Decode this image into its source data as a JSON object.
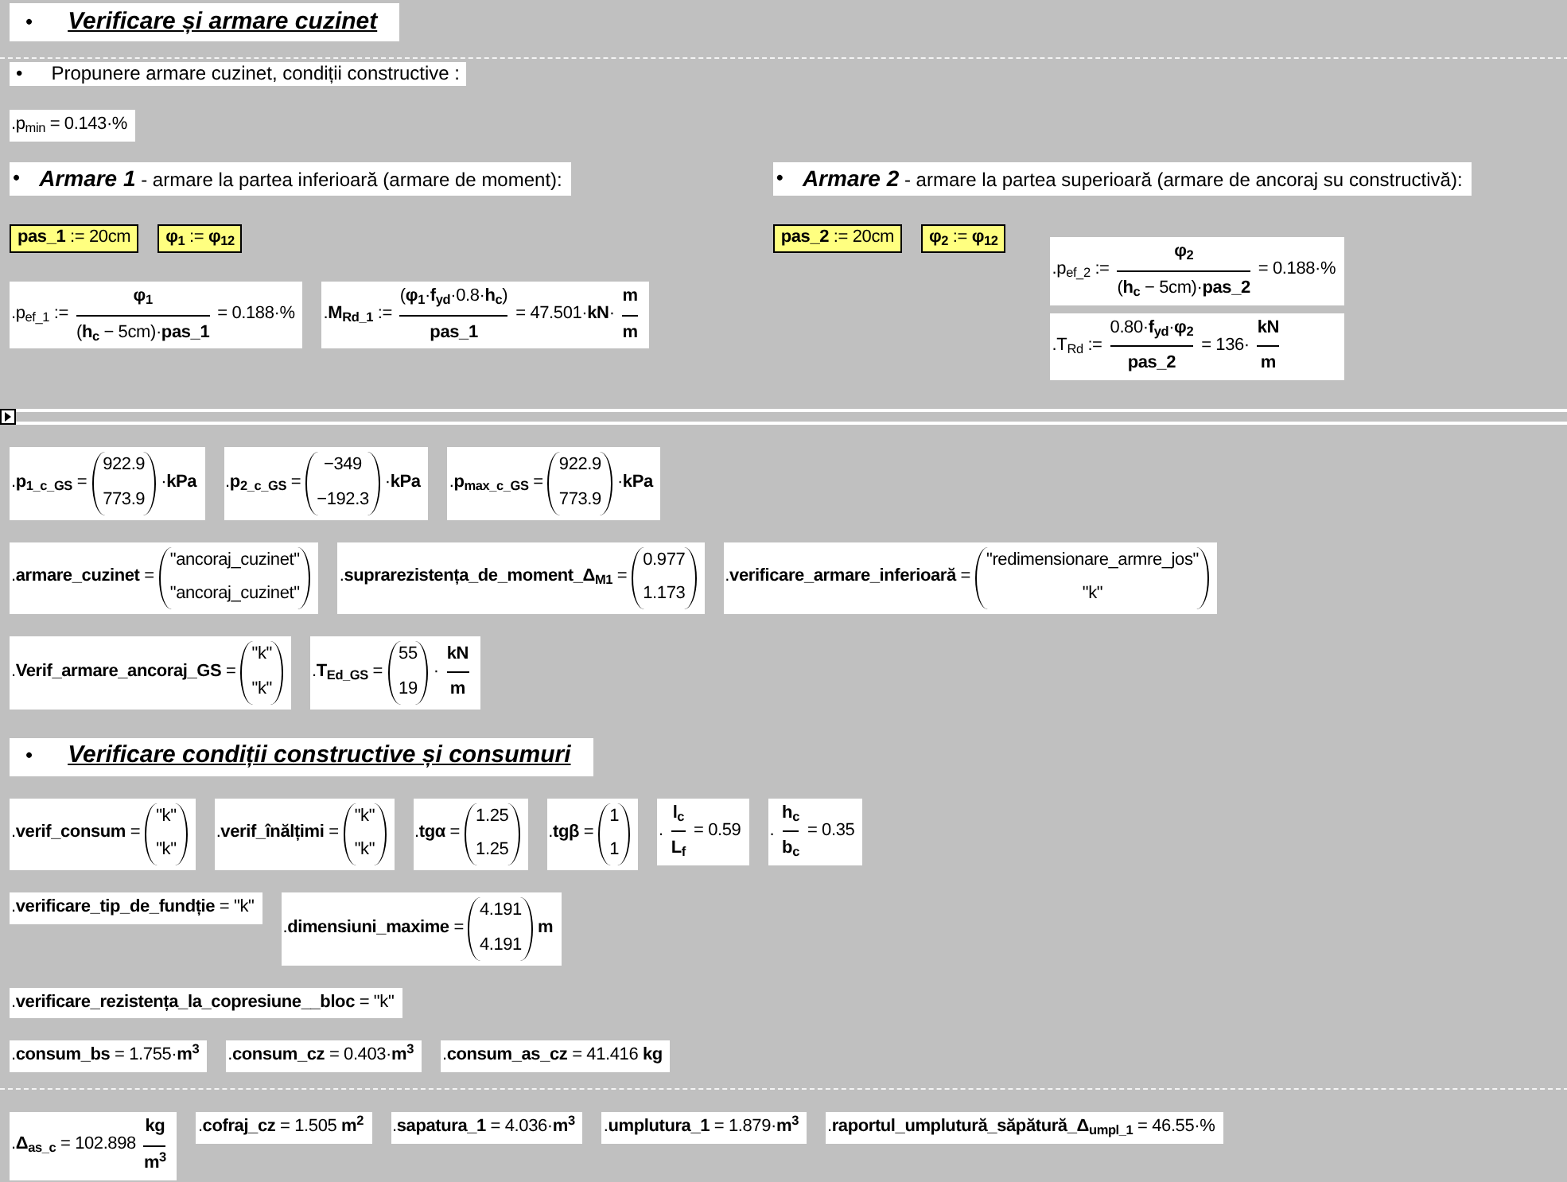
{
  "worksheet": {
    "blocks": [
      {
        "kind": "heading",
        "bullet": "•",
        "title": "Verificare și armare cuzinet"
      },
      {
        "kind": "page-break"
      },
      {
        "kind": "note",
        "bullet": "•",
        "text": "Propunere armare cuzinet, condiții constructive :"
      },
      {
        "kind": "math",
        "regions": [
          {
            "kind": "region",
            "parts": [
              {
                "kind": "text",
                "text": ".p$_{min}$ = 0.143·%"
              }
            ]
          }
        ]
      },
      {
        "kind": "columns",
        "columns": [
          {
            "blocks": [
              {
                "kind": "subheading",
                "bullet": "•",
                "title": "Armare 1",
                "text": "- armare la partea inferioară (armare de moment):"
              },
              {
                "kind": "math",
                "regions": [
                  {
                    "kind": "definition",
                    "parts": [
                      {
                        "kind": "text",
                        "text": "**pas_1** := 20cm"
                      }
                    ]
                  },
                  {
                    "kind": "definition",
                    "parts": [
                      {
                        "kind": "text",
                        "text": "**φ$_{1}$** := **φ$_{12}$**"
                      }
                    ]
                  }
                ]
              },
              {
                "kind": "math",
                "regions": [
                  {
                    "kind": "region",
                    "parts": [
                      {
                        "kind": "text",
                        "text": ".p$_{ef_1}$ :="
                      },
                      {
                        "kind": "frac",
                        "num": "**φ$_{1}$**",
                        "den": "(**h$_{c}$** − 5cm)·**pas_1**"
                      },
                      {
                        "kind": "text",
                        "text": "= 0.188·%"
                      }
                    ]
                  },
                  {
                    "kind": "region",
                    "parts": [
                      {
                        "kind": "text",
                        "text": ".**M$_{Rd_1}$** :="
                      },
                      {
                        "kind": "frac",
                        "num": "(**φ$_{1}$**·**f$_{yd}$**·0.8·**h$_{c}$**)",
                        "den": "**pas_1**"
                      },
                      {
                        "kind": "text",
                        "text": "= 47.501·**kN**·"
                      },
                      {
                        "kind": "frac",
                        "num": "**m**",
                        "den": "**m**"
                      }
                    ]
                  }
                ]
              }
            ]
          },
          {
            "blocks": [
              {
                "kind": "subheading",
                "bullet": "•",
                "title": "Armare 2",
                "text": "- armare la partea superioară (armare de ancoraj su constructivă):"
              },
              {
                "kind": "math",
                "regions": [
                  {
                    "kind": "definition",
                    "parts": [
                      {
                        "kind": "text",
                        "text": "**pas_2** := 20cm"
                      }
                    ]
                  },
                  {
                    "kind": "definition",
                    "parts": [
                      {
                        "kind": "text",
                        "text": "**φ$_{2}$** := **φ$_{12}$**"
                      }
                    ]
                  },
                  {
                    "kind": "stack",
                    "regions": [
                      {
                        "kind": "region",
                        "parts": [
                          {
                            "kind": "text",
                            "text": ".p$_{ef_2}$ :="
                          },
                          {
                            "kind": "frac",
                            "num": "**φ$_{2}$**",
                            "den": "(**h$_{c}$** − 5cm)·**pas_2**"
                          },
                          {
                            "kind": "text",
                            "text": "= 0.188·%"
                          }
                        ]
                      },
                      {
                        "kind": "region",
                        "parts": [
                          {
                            "kind": "text",
                            "text": ".T$_{Rd}$ :="
                          },
                          {
                            "kind": "frac",
                            "num": "0.80·**f$_{yd}$**·**φ$_{2}$**",
                            "den": "**pas_2**"
                          },
                          {
                            "kind": "text",
                            "text": "= 136·"
                          },
                          {
                            "kind": "frac",
                            "num": "**kN**",
                            "den": "**m**"
                          }
                        ]
                      }
                    ]
                  }
                ]
              }
            ]
          }
        ]
      },
      {
        "kind": "area-bar"
      },
      {
        "kind": "math",
        "regions": [
          {
            "kind": "region",
            "parts": [
              {
                "kind": "text",
                "text": ".**p$_{1_c_GS}$** ="
              },
              {
                "kind": "matrix",
                "rows": [
                  "922.9",
                  "773.9"
                ]
              },
              {
                "kind": "text",
                "text": "·**kPa**"
              }
            ]
          },
          {
            "kind": "region",
            "parts": [
              {
                "kind": "text",
                "text": ".**p$_{2_c_GS}$** ="
              },
              {
                "kind": "matrix",
                "rows": [
                  "−349",
                  "−192.3"
                ]
              },
              {
                "kind": "text",
                "text": "·**kPa**"
              }
            ]
          },
          {
            "kind": "region",
            "parts": [
              {
                "kind": "text",
                "text": ".**p$_{max_c_GS}$** ="
              },
              {
                "kind": "matrix",
                "rows": [
                  "922.9",
                  "773.9"
                ]
              },
              {
                "kind": "text",
                "text": "·**kPa**"
              }
            ]
          }
        ]
      },
      {
        "kind": "math",
        "regions": [
          {
            "kind": "region",
            "parts": [
              {
                "kind": "text",
                "text": ".**armare_cuzinet** ="
              },
              {
                "kind": "matrix",
                "rows": [
                  "\"ancoraj_cuzinet\"",
                  "\"ancoraj_cuzinet\""
                ]
              }
            ]
          },
          {
            "kind": "region",
            "parts": [
              {
                "kind": "text",
                "text": ".**suprarezistența_de_moment_Δ$_{M1}$** ="
              },
              {
                "kind": "matrix",
                "rows": [
                  "0.977",
                  "1.173"
                ]
              }
            ]
          },
          {
            "kind": "region",
            "parts": [
              {
                "kind": "text",
                "text": ".**verificare_armare_inferioară** ="
              },
              {
                "kind": "matrix",
                "rows": [
                  "\"redimensionare_armre_jos\"",
                  "\"k\""
                ]
              }
            ]
          }
        ]
      },
      {
        "kind": "math",
        "regions": [
          {
            "kind": "region",
            "parts": [
              {
                "kind": "text",
                "text": ".**Verif_armare_ancoraj_GS** ="
              },
              {
                "kind": "matrix",
                "rows": [
                  "\"k\"",
                  "\"k\""
                ]
              }
            ]
          },
          {
            "kind": "region",
            "parts": [
              {
                "kind": "text",
                "text": ".**T$_{Ed_GS}$** ="
              },
              {
                "kind": "matrix",
                "rows": [
                  "55",
                  "19"
                ]
              },
              {
                "kind": "text",
                "text": "·"
              },
              {
                "kind": "frac",
                "num": "**kN**",
                "den": "**m**"
              }
            ]
          }
        ]
      },
      {
        "kind": "heading",
        "bullet": "•",
        "title": "Verificare condiții constructive și consumuri"
      },
      {
        "kind": "math",
        "regions": [
          {
            "kind": "region",
            "parts": [
              {
                "kind": "text",
                "text": ".**verif_consum** ="
              },
              {
                "kind": "matrix",
                "rows": [
                  "\"k\"",
                  "\"k\""
                ]
              }
            ]
          },
          {
            "kind": "region",
            "parts": [
              {
                "kind": "text",
                "text": ".**verif_înălțimi** ="
              },
              {
                "kind": "matrix",
                "rows": [
                  "\"k\"",
                  "\"k\""
                ]
              }
            ]
          },
          {
            "kind": "region",
            "parts": [
              {
                "kind": "text",
                "text": ".**tgα** ="
              },
              {
                "kind": "matrix",
                "rows": [
                  "1.25",
                  "1.25"
                ]
              }
            ]
          },
          {
            "kind": "region",
            "parts": [
              {
                "kind": "text",
                "text": ".**tgβ** ="
              },
              {
                "kind": "matrix",
                "rows": [
                  "1",
                  "1"
                ]
              }
            ]
          },
          {
            "kind": "region",
            "parts": [
              {
                "kind": "text",
                "text": "."
              },
              {
                "kind": "frac",
                "num": "**l$_{c}$**",
                "den": "**L$_{f}$**"
              },
              {
                "kind": "text",
                "text": "= 0.59"
              }
            ]
          },
          {
            "kind": "region",
            "parts": [
              {
                "kind": "text",
                "text": "."
              },
              {
                "kind": "frac",
                "num": "**h$_{c}$**",
                "den": "**b$_{c}$**"
              },
              {
                "kind": "text",
                "text": "= 0.35"
              }
            ]
          }
        ]
      },
      {
        "kind": "math",
        "regions": [
          {
            "kind": "region",
            "parts": [
              {
                "kind": "text",
                "text": ".**verificare_tip_de_fundție** = \"k\""
              }
            ]
          },
          {
            "kind": "region",
            "parts": [
              {
                "kind": "text",
                "text": ".**dimensiuni_maxime** ="
              },
              {
                "kind": "matrix",
                "rows": [
                  "4.191",
                  "4.191"
                ]
              },
              {
                "kind": "text",
                "text": "**m**"
              }
            ]
          }
        ]
      },
      {
        "kind": "math",
        "regions": [
          {
            "kind": "region",
            "parts": [
              {
                "kind": "text",
                "text": ".**verificare_rezistența_la_copresiune__bloc** = \"k\""
              }
            ]
          }
        ]
      },
      {
        "kind": "math",
        "regions": [
          {
            "kind": "region",
            "parts": [
              {
                "kind": "text",
                "text": ".**consum_bs** = 1.755·**m$^{3}$**"
              }
            ]
          },
          {
            "kind": "region",
            "parts": [
              {
                "kind": "text",
                "text": ".**consum_cz** = 0.403·**m$^{3}$**"
              }
            ]
          },
          {
            "kind": "region",
            "parts": [
              {
                "kind": "text",
                "text": ".**consum_as_cz** = 41.416 **kg**"
              }
            ]
          }
        ]
      },
      {
        "kind": "page-break"
      },
      {
        "kind": "math",
        "regions": [
          {
            "kind": "region",
            "parts": [
              {
                "kind": "text",
                "text": ".**Δ$_{as_c}$** = 102.898"
              },
              {
                "kind": "frac",
                "num": "**kg**",
                "den": "**m$^{3}$**"
              }
            ]
          },
          {
            "kind": "region",
            "parts": [
              {
                "kind": "text",
                "text": ".**cofraj_cz** = 1.505 **m$^{2}$**"
              }
            ]
          },
          {
            "kind": "region",
            "parts": [
              {
                "kind": "text",
                "text": ".**sapatura_1** = 4.036·**m$^{3}$**"
              }
            ]
          },
          {
            "kind": "region",
            "parts": [
              {
                "kind": "text",
                "text": ".**umplutura_1** = 1.879·**m$^{3}$**"
              }
            ]
          },
          {
            "kind": "region",
            "parts": [
              {
                "kind": "text",
                "text": ".**raportul_umplutură_săpătură_Δ$_{umpl_1}$** = 46.55·%"
              }
            ]
          }
        ]
      }
    ]
  }
}
